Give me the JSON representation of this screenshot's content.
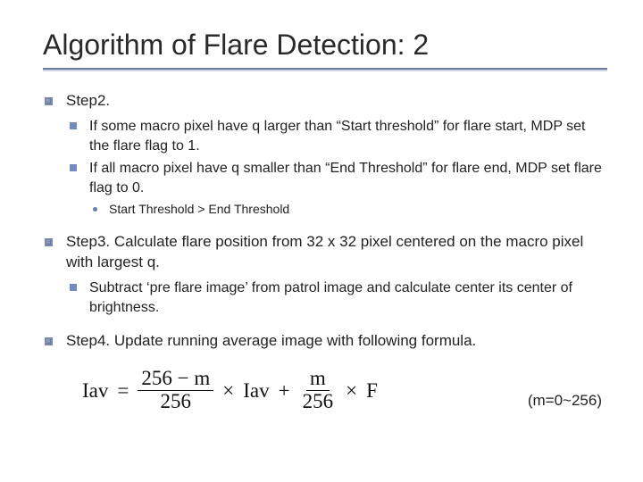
{
  "title": "Algorithm of Flare Detection: 2",
  "steps": {
    "step2": {
      "label": "Step2.",
      "sub": [
        "If some macro pixel have q larger than “Start threshold” for flare start, MDP set the flare flag to 1.",
        "If all macro pixel have q smaller than “End Threshold” for flare end, MDP set flare flag to 0."
      ],
      "note": "Start Threshold > End Threshold"
    },
    "step3": {
      "label": "Step3. Calculate flare position from 32 x 32 pixel centered on the macro pixel with largest q.",
      "sub": [
        "Subtract ‘pre flare image’ from patrol image and calculate center its center of brightness."
      ]
    },
    "step4": {
      "label": "Step4. Update running average image with following formula."
    }
  },
  "formula": {
    "lhs": "Iav",
    "eq": "=",
    "frac1_num": "256 − m",
    "frac1_den": "256",
    "times": "×",
    "mid": "Iav",
    "plus": "+",
    "frac2_num": "m",
    "frac2_den": "256",
    "rhs": "F"
  },
  "m_note": "(m=0~256)"
}
